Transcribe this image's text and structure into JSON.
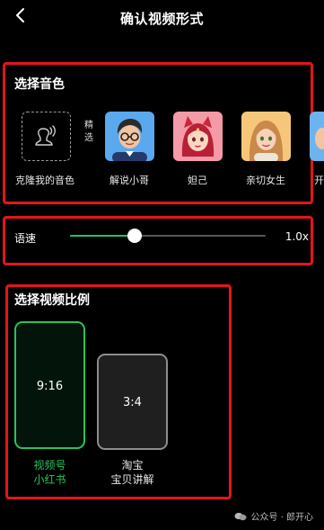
{
  "header": {
    "title": "确认视频形式"
  },
  "voice": {
    "title": "选择音色",
    "featured_tag": "精选",
    "clone_label": "克隆我的音色",
    "items": [
      {
        "label": "解说小哥",
        "icon": "avatar-narrator-boy-icon"
      },
      {
        "label": "妲己",
        "icon": "avatar-daji-icon"
      },
      {
        "label": "亲切女生",
        "icon": "avatar-friendly-girl-icon"
      },
      {
        "label": "开"
      }
    ]
  },
  "speed": {
    "label": "语速",
    "value": "1.0x",
    "level": 0.33
  },
  "ratio": {
    "title": "选择视频比例",
    "options": [
      {
        "ratio": "9:16",
        "caption_line1": "视频号",
        "caption_line2": "小红书",
        "selected": true
      },
      {
        "ratio": "3:4",
        "caption_line1": "淘宝",
        "caption_line2": "宝贝讲解",
        "selected": false
      }
    ]
  },
  "watermark": {
    "text": "公众号 · 郎开心"
  },
  "colors": {
    "accent": "#22c55e",
    "highlight_box": "#e4141b",
    "background": "#000000"
  }
}
